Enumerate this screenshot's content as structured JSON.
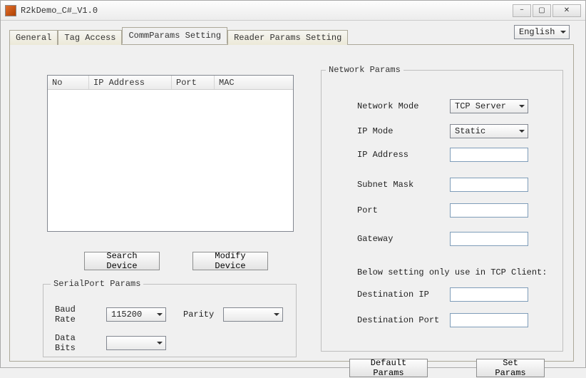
{
  "window": {
    "title": "R2kDemo_C#_V1.0"
  },
  "language": {
    "selected": "English"
  },
  "tabs": {
    "general": "General",
    "tag_access": "Tag Access",
    "comm_params": "CommParams Setting",
    "reader_params": "Reader Params Setting"
  },
  "table": {
    "cols": {
      "no": "No",
      "ip": "IP Address",
      "port": "Port",
      "mac": "MAC"
    }
  },
  "buttons": {
    "search_device": "Search Device",
    "modify_device": "Modify Device",
    "default_params": "Default Params",
    "set_params": "Set Params"
  },
  "serial": {
    "legend": "SerialPort Params",
    "baud_label": "Baud Rate",
    "baud_value": "115200",
    "parity_label": "Parity",
    "parity_value": "",
    "data_bits_label": "Data Bits",
    "data_bits_value": ""
  },
  "network": {
    "legend": "Network Params",
    "mode_label": "Network Mode",
    "mode_value": "TCP Server",
    "ipmode_label": "IP Mode",
    "ipmode_value": "Static",
    "ip_label": "IP Address",
    "ip_value": "",
    "subnet_label": "Subnet Mask",
    "subnet_value": "",
    "port_label": "Port",
    "port_value": "",
    "gateway_label": "Gateway",
    "gateway_value": "",
    "below_note": "Below setting only use in TCP Client:",
    "dest_ip_label": "Destination IP",
    "dest_ip_value": "",
    "dest_port_label": "Destination Port",
    "dest_port_value": ""
  }
}
